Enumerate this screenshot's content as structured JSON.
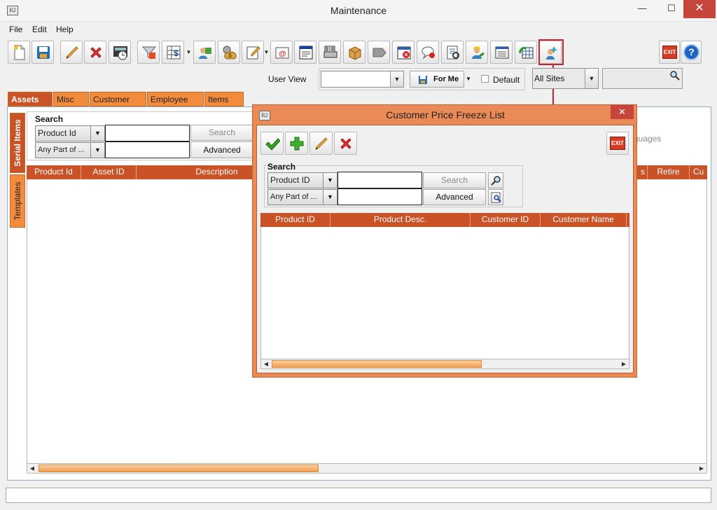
{
  "window": {
    "title": "Maintenance",
    "app_icon": "R2",
    "minimize": "—",
    "maximize": "☐",
    "close": "✕"
  },
  "menu": {
    "file": "File",
    "edit": "Edit",
    "help": "Help"
  },
  "toolbar": {
    "exit_label": "EXIT",
    "help_label": "?"
  },
  "user_view": {
    "label": "User View",
    "value": "",
    "for_me_label": "For Me",
    "default_label": "Default",
    "default_checked": false,
    "sites_value": "All Sites",
    "search_value": ""
  },
  "tabs": [
    {
      "label": "Assets",
      "active": true
    },
    {
      "label": "Misc"
    },
    {
      "label": "Customer"
    },
    {
      "label": "Employee"
    },
    {
      "label": "Items"
    }
  ],
  "side_tabs": [
    {
      "label": "Serial Items",
      "active": true
    },
    {
      "label": "Templates"
    }
  ],
  "main_search": {
    "title": "Search",
    "field_select": "Product Id",
    "match_select": "Any Part of ...",
    "search_value": "",
    "match_value": "",
    "search_button": "Search",
    "advanced_button": "Advanced",
    "partial_hint": "guages"
  },
  "main_grid": {
    "columns": [
      "Product Id",
      "Asset ID",
      "Description",
      "s",
      "Retire",
      "Cu"
    ]
  },
  "dialog": {
    "title": "Customer Price Freeze List",
    "icon": "R2",
    "close": "✕",
    "exit_label": "EXIT",
    "search": {
      "title": "Search",
      "field_select": "Product ID",
      "match_select": "Any Part of ...",
      "search_value": "",
      "match_value": "",
      "search_button": "Search",
      "advanced_button": "Advanced"
    },
    "columns": [
      "Product ID",
      "Product Desc.",
      "Customer ID",
      "Customer Name"
    ]
  },
  "colors": {
    "accent": "#c95227",
    "tab": "#f28c3c",
    "dialog_frame": "#ea8a57",
    "highlight": "#c8232c"
  }
}
